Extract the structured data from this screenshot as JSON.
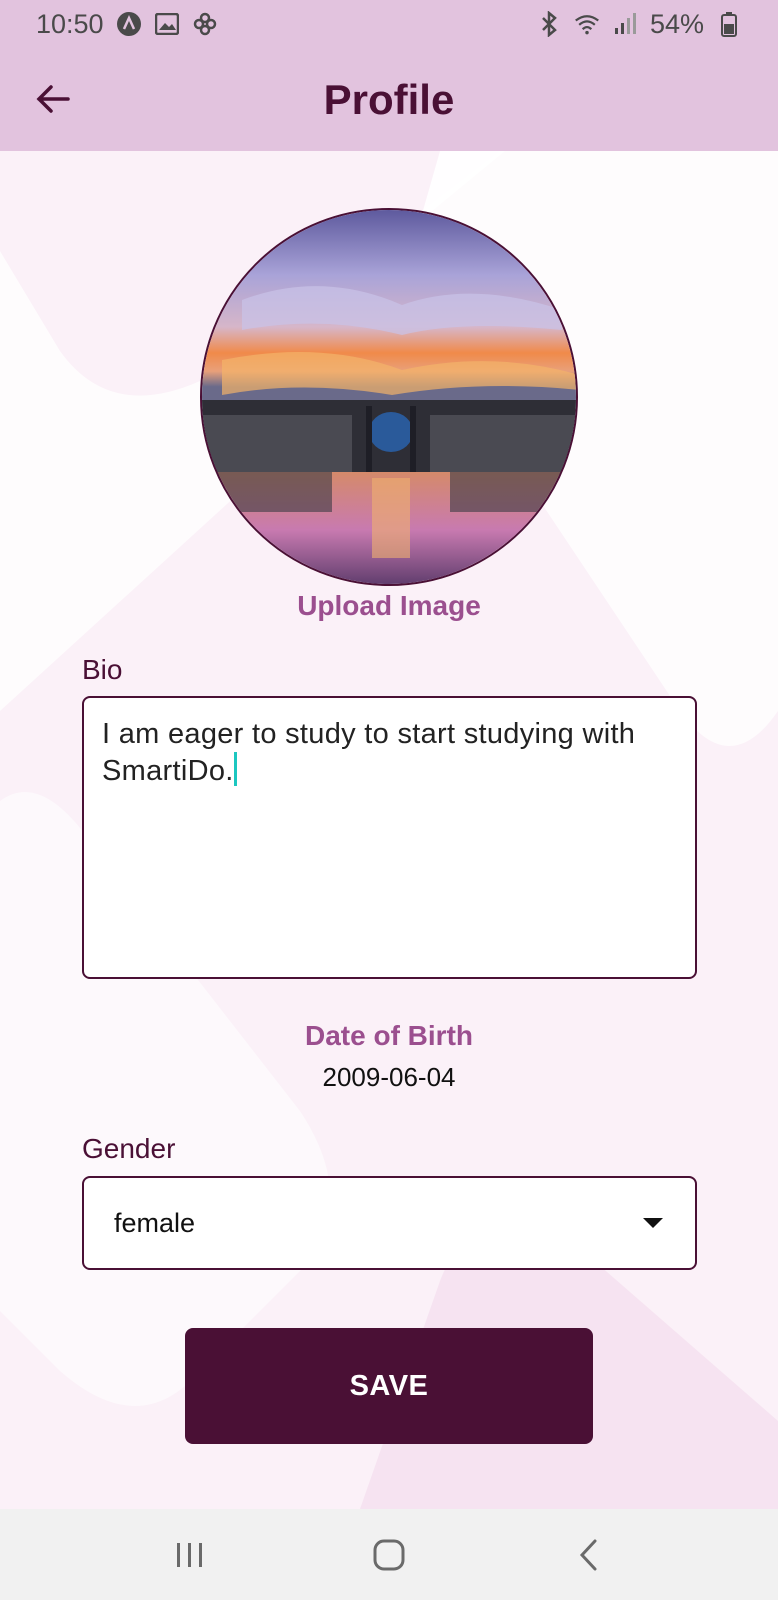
{
  "status_bar": {
    "time": "10:50",
    "battery": "54%",
    "left_icons": [
      "app-icon",
      "image-icon",
      "pinwheel-icon"
    ],
    "right_icons": [
      "bluetooth-icon",
      "wifi-icon",
      "signal-icon",
      "battery-icon"
    ]
  },
  "app_bar": {
    "title": "Profile",
    "back_icon": "arrow-left-icon"
  },
  "profile": {
    "upload_label": "Upload Image",
    "bio_label": "Bio",
    "bio_value": "I am eager to study to start studying with SmartiDo.",
    "dob_label": "Date of Birth",
    "dob_value": "2009-06-04",
    "gender_label": "Gender",
    "gender_value": "female",
    "save_label": "SAVE"
  },
  "nav_bar": {
    "icons": [
      "recents-icon",
      "home-icon",
      "back-icon"
    ]
  },
  "colors": {
    "app_bar": "#e2c3de",
    "primary": "#4a1035",
    "accent_text": "#9b4f8f",
    "background": "#fbf1f8",
    "caret": "#1cc7c0"
  }
}
